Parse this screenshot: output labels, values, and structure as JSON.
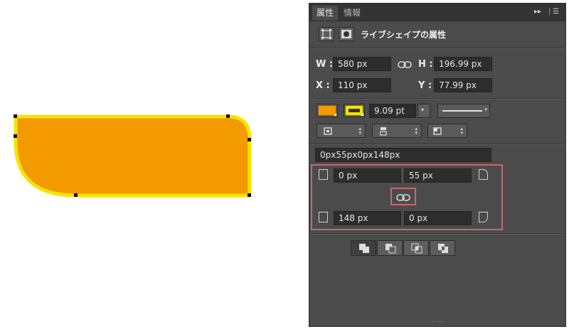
{
  "panel": {
    "tabs": [
      {
        "label": "属性"
      },
      {
        "label": "情報"
      }
    ],
    "header": {
      "title": "ライブシェイプの属性"
    },
    "transform": {
      "w_label": "W :",
      "w_value": "580 px",
      "h_label": "H :",
      "h_value": "196.99 px",
      "x_label": "X :",
      "x_value": "110 px",
      "y_label": "Y :",
      "y_value": "77.99 px"
    },
    "appearance": {
      "fill_color": "#f29a00",
      "stroke_color": "#f5e400",
      "stroke_width": "9.09 pt"
    },
    "corners": {
      "summary": "0px55px0px148px",
      "top_left": "0 px",
      "top_right": "55 px",
      "bottom_left": "148 px",
      "bottom_right": "0 px"
    }
  },
  "canvas": {
    "shape_fill": "#f29a00",
    "shape_stroke": "#f5e400"
  },
  "colors": {
    "panel_bg": "#4b4b4b",
    "highlight": "#c9686e"
  }
}
